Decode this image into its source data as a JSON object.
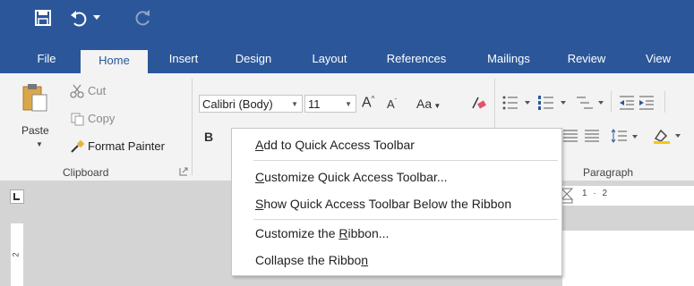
{
  "tabs": [
    "File",
    "Home",
    "Insert",
    "Design",
    "Layout",
    "References",
    "Mailings",
    "Review",
    "View"
  ],
  "clipboard": {
    "paste_label": "Paste",
    "cut_label": "Cut",
    "copy_label": "Copy",
    "format_painter_label": "Format Painter",
    "group_label": "Clipboard"
  },
  "font": {
    "family_value": "Calibri (Body)",
    "size_value": "11",
    "case_label": "Aa",
    "bold_label": "B"
  },
  "paragraph": {
    "group_label": "Paragraph"
  },
  "ruler": {
    "marks": "1 · 2",
    "vertical_marks": "2"
  },
  "context_menu": {
    "items": [
      {
        "label_before": "",
        "accel": "A",
        "label_after": "dd to Quick Access Toolbar"
      },
      {
        "label_before": "",
        "accel": "C",
        "label_after": "ustomize Quick Access Toolbar..."
      },
      {
        "label_before": "",
        "accel": "S",
        "label_after": "how Quick Access Toolbar Below the Ribbon"
      },
      {
        "label_before": "Customize the ",
        "accel": "R",
        "label_after": "ibbon..."
      },
      {
        "label_before": "Collapse the Ribbo",
        "accel": "n",
        "label_after": ""
      }
    ]
  },
  "colors": {
    "brand": "#2b579a",
    "ribbon_bg": "#f3f3f3",
    "doc_bg": "#d4d4d4"
  }
}
